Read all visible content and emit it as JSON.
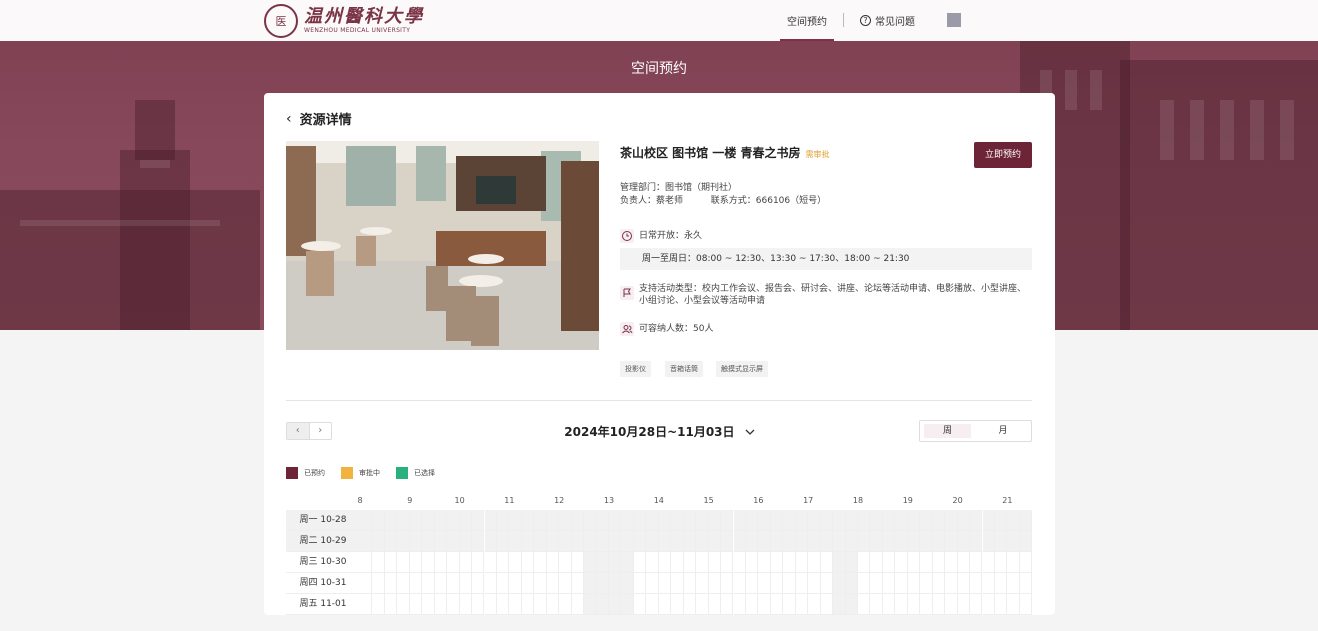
{
  "header": {
    "logo_seal": "医",
    "logo_cn": "温州醫科大學",
    "logo_en": "WENZHOU MEDICAL UNIVERSITY",
    "nav_active": "空间预约",
    "nav_help": "常见问题",
    "help_icon_glyph": "?"
  },
  "page_title": "空间预约",
  "detail": {
    "back_label": "资源详情",
    "title": "茶山校区 图书馆 一楼 青春之书房",
    "badge": "需审批",
    "book_button": "立即预约",
    "department": "管理部门：图书馆（期刊社）",
    "contact_person": "负责人：蔡老师",
    "contact_phone": "联系方式：666106（短号）",
    "open_label": "日常开放：永久",
    "hours": "周一至周日：08:00 ~ 12:30、13:30 ~ 17:30、18:00 ~ 21:30",
    "activities": "支持活动类型：校内工作会议、报告会、研讨会、讲座、论坛等活动申请、电影播放、小型讲座、小组讨论、小型会议等活动申请",
    "capacity": "可容纳人数：50人",
    "tags": [
      "投影仪",
      "音箱话筒",
      "触摸式显示屏"
    ]
  },
  "calendar": {
    "date_range": "2024年10月28日~11月03日",
    "view_week": "周",
    "view_month": "月",
    "legend": [
      {
        "label": "已预约",
        "color": "#6e2437"
      },
      {
        "label": "审批中",
        "color": "#f2b23f"
      },
      {
        "label": "已选择",
        "color": "#2ab07f"
      }
    ],
    "hours": [
      "8",
      "9",
      "10",
      "11",
      "12",
      "13",
      "14",
      "15",
      "16",
      "17",
      "18",
      "19",
      "20",
      "21"
    ],
    "days": [
      "周一 10-28",
      "周二 10-29",
      "周三 10-30",
      "周四 10-31",
      "周五 11-01"
    ]
  }
}
